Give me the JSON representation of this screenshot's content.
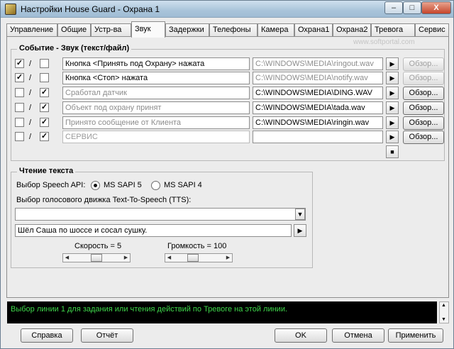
{
  "window": {
    "title": "Настройки House Guard - Охрана 1",
    "min": "–",
    "max": "□",
    "close": "X"
  },
  "tabs": [
    "Управление",
    "Общие",
    "Устр-ва",
    "Звук",
    "Задержки",
    "Телефоны",
    "Камера",
    "Охрана1",
    "Охрана2",
    "Тревога",
    "Сервис"
  ],
  "active_tab": "Звук",
  "watermark": "www.softportal.com",
  "sound_group": {
    "title": "Событие - Звук (текст/файл)",
    "rows": [
      {
        "c1": "✓",
        "c2": "",
        "event": "Кнопка <Принять под Охрану> нажата",
        "file": "C:\\WINDOWS\\MEDIA\\ringout.wav",
        "browse": "Обзор..."
      },
      {
        "c1": "✓",
        "c2": "",
        "event": "Кнопка <Стоп> нажата",
        "file": "C:\\WINDOWS\\MEDIA\\notify.wav",
        "browse": "Обзор..."
      },
      {
        "c1": "",
        "c2": "✓",
        "event": "Сработал датчик",
        "file": "C:\\WINDOWS\\MEDIA\\DING.WAV",
        "browse": "Обзор..."
      },
      {
        "c1": "",
        "c2": "✓",
        "event": "Объект под охрану принят",
        "file": "C:\\WINDOWS\\MEDIA\\tada.wav",
        "browse": "Обзор..."
      },
      {
        "c1": "",
        "c2": "✓",
        "event": "Принято сообщение от Клиента",
        "file": "C:\\WINDOWS\\MEDIA\\ringin.wav",
        "browse": "Обзор..."
      },
      {
        "c1": "",
        "c2": "✓",
        "event": "СЕРВИС",
        "file": "",
        "browse": "Обзор..."
      }
    ],
    "slash": "/",
    "play": "▶",
    "stop": "■"
  },
  "tts_group": {
    "title": "Чтение текста",
    "api_label": "Выбор Speech API:",
    "api5": "MS SAPI 5",
    "api4": "MS SAPI 4",
    "engine_label": "Выбор голосового движка Text-To-Speech (TTS):",
    "engine_value": "",
    "test_text": "Шёл Саша по шоссе и сосал сушку.",
    "speed_label": "Скорость = 5",
    "volume_label": "Громкость = 100",
    "speed_value": 5,
    "volume_value": 100
  },
  "status_text": "Выбор линии 1 для задания или чтения действий по Тревоге на этой линии.",
  "buttons": {
    "help": "Справка",
    "report": "Отчёт",
    "ok": "OK",
    "cancel": "Отмена",
    "apply": "Применить"
  }
}
